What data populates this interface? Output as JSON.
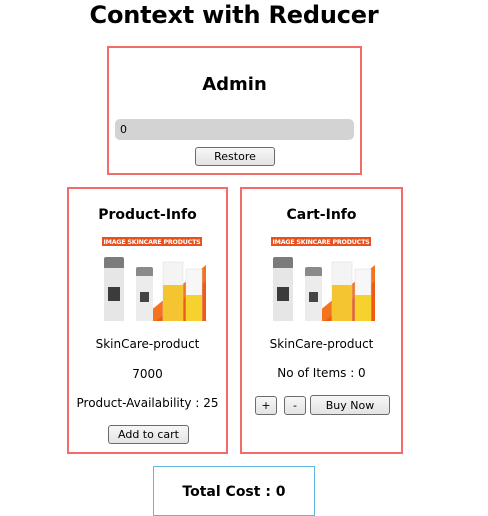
{
  "page": {
    "title": "Context with Reducer"
  },
  "admin": {
    "title": "Admin",
    "input_value": "0",
    "restore_label": "Restore"
  },
  "product_info": {
    "title": "Product-Info",
    "image_banner": "IMAGE SKINCARE PRODUCTS",
    "name": "SkinCare-product",
    "price": "7000",
    "availability": "Product-Availability : 25",
    "add_to_cart_label": "Add to cart"
  },
  "cart_info": {
    "title": "Cart-Info",
    "image_banner": "IMAGE SKINCARE PRODUCTS",
    "name": "SkinCare-product",
    "items_text": "No of Items : 0",
    "plus_label": "+",
    "minus_label": "-",
    "buy_now_label": "Buy Now"
  },
  "total": {
    "text": "Total Cost : 0"
  },
  "colors": {
    "panel_border": "#f46b6b",
    "total_border": "#5fb8de",
    "banner": "#e8501e"
  }
}
